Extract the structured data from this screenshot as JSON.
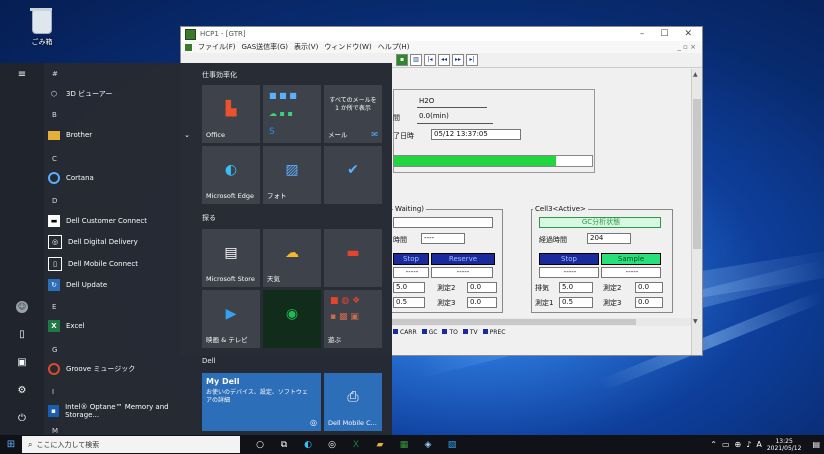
{
  "desktop": {
    "recycle_bin_label": "ごみ箱"
  },
  "app": {
    "title": "HCP1 - [GTR]",
    "menu": [
      "ファイル(F)",
      "GAS送信率(G)",
      "表示(V)",
      "ウィンドウ(W)",
      "ヘルプ(H)"
    ],
    "top": {
      "gas": "H2O",
      "time_label": "間",
      "time": "0.0(min)",
      "end_label": "了日時",
      "end_time": "05/12 13:37:05",
      "progress": 0.82
    },
    "left_panel": {
      "caption": "Waiting)",
      "elapsed_label": "時間",
      "elapsed": "----",
      "stop": "Stop",
      "reserve": "Reserve",
      "dash1": "-----",
      "dash2": "-----",
      "v1": "5.0",
      "m2_label": "測定2",
      "m2": "0.0",
      "v2": "0.5",
      "m3_label": "測定3",
      "m3": "0.0"
    },
    "right_panel": {
      "caption": "Cell3<Active>",
      "status": "GC分析状態",
      "elapsed_label": "経過時間",
      "elapsed": "204",
      "stop": "Stop",
      "sample": "Sample",
      "dash1": "-----",
      "dash2": "-----",
      "exhaust_label": "排気",
      "exhaust": "5.0",
      "m2_label": "測定2",
      "m2": "0.0",
      "m1_label": "測定1",
      "m1": "0.5",
      "m3_label": "測定3",
      "m3": "0.0"
    },
    "legend": [
      "CARR",
      "GC",
      "TO",
      "TV",
      "PREC"
    ]
  },
  "start": {
    "apps": [
      {
        "type": "header",
        "text": "#"
      },
      {
        "type": "item",
        "text": "3D ビューアー",
        "icon": "cube-icon"
      },
      {
        "type": "header",
        "text": "B"
      },
      {
        "type": "item",
        "text": "Brother",
        "icon": "folder-icon"
      },
      {
        "type": "header",
        "text": "C"
      },
      {
        "type": "item",
        "text": "Cortana",
        "icon": "cortana-icon"
      },
      {
        "type": "header",
        "text": "D"
      },
      {
        "type": "item",
        "text": "Dell Customer Connect",
        "icon": "chat-icon"
      },
      {
        "type": "item",
        "text": "Dell Digital Delivery",
        "icon": "delivery-icon"
      },
      {
        "type": "item",
        "text": "Dell Mobile Connect",
        "icon": "phone-icon"
      },
      {
        "type": "item",
        "text": "Dell Update",
        "icon": "update-icon"
      },
      {
        "type": "header",
        "text": "E"
      },
      {
        "type": "item",
        "text": "Excel",
        "icon": "excel-icon"
      },
      {
        "type": "header",
        "text": "G"
      },
      {
        "type": "item",
        "text": "Groove ミュージック",
        "icon": "groove-icon"
      },
      {
        "type": "header",
        "text": "I"
      },
      {
        "type": "item",
        "text": "Intel® Optane™ Memory and Storage...",
        "icon": "intel-icon"
      },
      {
        "type": "header",
        "text": "M"
      }
    ],
    "groups": {
      "productivity": "仕事効率化",
      "explore": "探る",
      "dell": "Dell"
    },
    "tiles": {
      "office": "Office",
      "mail_promo": "すべてのメールを 1 か所で表示",
      "mail": "メール",
      "edge": "Microsoft Edge",
      "photos": "フォト",
      "store": "Microsoft Store",
      "weather": "天気",
      "movies": "映画 & テレビ",
      "play": "遊ぶ",
      "mydell_title": "My Dell",
      "mydell_desc": "お使いのデバイス、設定、ソフトウェアの詳細",
      "dell_mobile": "Dell Mobile C..."
    }
  },
  "taskbar": {
    "search_placeholder": "ここに入力して検索",
    "ime": "A",
    "time": "13:25",
    "date": "2021/05/12"
  },
  "colors": {
    "progress": "#22d640",
    "active_button": "#27e07a",
    "dark_button": "#1a2a9a",
    "start_bg": "#262a33"
  }
}
